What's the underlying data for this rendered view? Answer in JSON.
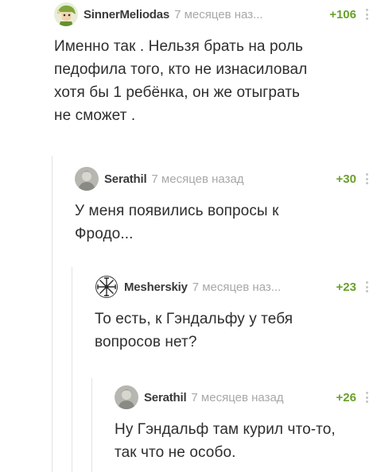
{
  "comments": [
    {
      "author": "SinnerMeliodas",
      "time": "7 месяцев наз...",
      "rating": "+106",
      "avatar_icon": "cartoon-character-avatar-icon",
      "lines": [
        "Именно так . Нельзя брать на роль",
        "педофила того, кто не изнасиловал",
        "хотя бы 1 ребёнка, он же отыграть",
        "не сможет ."
      ]
    },
    {
      "author": "Serathil",
      "time": "7 месяцев назад",
      "rating": "+30",
      "avatar_icon": "portrait-avatar-icon",
      "lines": [
        "У меня появились вопросы к",
        "Фродо..."
      ]
    },
    {
      "author": "Mesherskiy",
      "time": "7 месяцев наз...",
      "rating": "+23",
      "avatar_icon": "vegvisir-symbol-avatar-icon",
      "lines": [
        "То есть, к Гэндальфу у тебя",
        "вопросов нет?"
      ]
    },
    {
      "author": "Serathil",
      "time": "7 месяцев назад",
      "rating": "+26",
      "avatar_icon": "portrait-avatar-icon",
      "lines": [
        "Ну Гэндальф там курил что-то,",
        "так что не особо."
      ]
    }
  ],
  "colors": {
    "rating": "#6aa02a",
    "meta": "#a8a8a8",
    "thread_line": "#e2e2e2",
    "text": "#2e2e2e"
  }
}
